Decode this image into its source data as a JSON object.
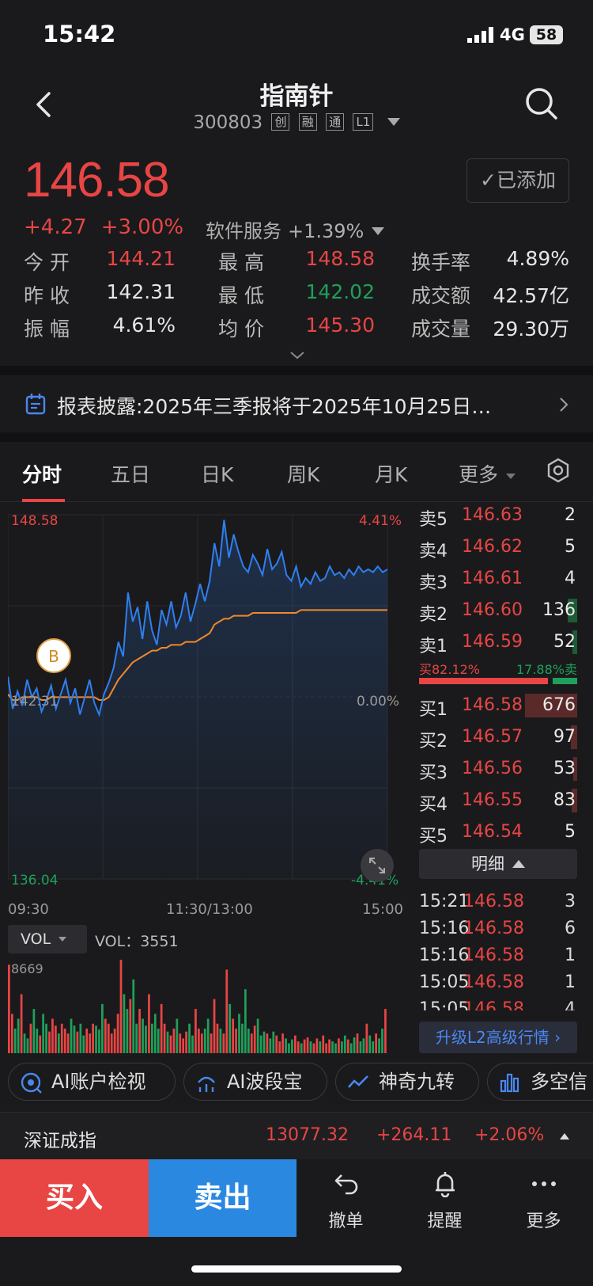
{
  "status": {
    "time": "15:42",
    "network": "4G",
    "battery": "58"
  },
  "header": {
    "title": "指南针",
    "code": "300803",
    "tags": [
      "创",
      "融",
      "通",
      "L1"
    ]
  },
  "quote": {
    "price": "146.58",
    "change": "+4.27",
    "change_pct": "+3.00%",
    "sector": "软件服务",
    "sector_pct": "+1.39%",
    "added_label": "已添加"
  },
  "stats": {
    "open_k": "今 开",
    "open_v": "144.21",
    "high_k": "最 高",
    "high_v": "148.58",
    "turnover_k": "换手率",
    "turnover_v": "4.89%",
    "prev_k": "昨 收",
    "prev_v": "142.31",
    "low_k": "最 低",
    "low_v": "142.02",
    "amount_k": "成交额",
    "amount_v": "42.57亿",
    "amp_k": "振 幅",
    "amp_v": "4.61%",
    "avg_k": "均 价",
    "avg_v": "145.30",
    "volume_k": "成交量",
    "volume_v": "29.30万"
  },
  "notice": "报表披露:2025年三季报将于2025年10月25日…",
  "tabs": [
    "分时",
    "五日",
    "日K",
    "周K",
    "月K",
    "更多"
  ],
  "chart_labels": {
    "top_price": "148.58",
    "mid_price": "142.31",
    "bottom_price": "136.04",
    "top_pct": "4.41%",
    "mid_pct": "0.00%",
    "bottom_pct": "-4.41%",
    "marker": "B",
    "time_start": "09:30",
    "time_mid": "11:30/13:00",
    "time_end": "15:00"
  },
  "chart_data": {
    "type": "line",
    "title": "",
    "ylim": [
      136.04,
      148.58
    ],
    "prev_close": 142.31,
    "x": [
      "09:30",
      "11:30/13:00",
      "15:00"
    ],
    "series": [
      {
        "values": [
          143.0,
          141.9,
          142.5,
          142.0,
          142.9,
          142.3,
          142.6,
          141.8,
          142.2,
          142.7,
          141.9,
          142.4,
          142.9,
          142.1,
          142.6,
          141.7,
          142.3,
          142.9,
          142.1,
          141.7,
          142.4,
          142.8,
          143.3,
          144.2,
          143.7,
          145.9,
          144.9,
          145.4,
          144.3,
          145.6,
          144.6,
          144.1,
          145.3,
          144.8,
          145.6,
          144.7,
          145.1,
          145.9,
          144.9,
          145.5,
          146.2,
          145.6,
          146.3,
          147.6,
          146.8,
          148.4,
          147.1,
          147.9,
          147.3,
          146.8,
          146.6,
          147.2,
          146.9,
          146.5,
          147.4,
          146.7,
          146.9,
          147.3,
          146.5,
          146.3,
          146.8,
          146.1,
          146.4,
          146.2,
          146.6,
          146.3,
          146.4,
          146.8,
          146.5,
          146.6,
          146.4,
          146.7,
          146.5,
          146.8,
          146.6,
          146.7,
          146.6,
          146.8,
          146.6,
          146.7
        ]
      },
      {
        "values": [
          142.4,
          142.2,
          142.2,
          142.3,
          142.3,
          142.3,
          142.3,
          142.2,
          142.2,
          142.3,
          142.3,
          142.3,
          142.3,
          142.3,
          142.3,
          142.3,
          142.3,
          142.3,
          142.3,
          142.2,
          142.2,
          142.3,
          142.6,
          142.9,
          143.1,
          143.3,
          143.5,
          143.6,
          143.7,
          143.8,
          143.9,
          143.9,
          144.0,
          144.0,
          144.1,
          144.1,
          144.1,
          144.2,
          144.2,
          144.2,
          144.3,
          144.4,
          144.5,
          144.8,
          144.9,
          145.0,
          145.0,
          145.1,
          145.1,
          145.1,
          145.1,
          145.2,
          145.2,
          145.2,
          145.2,
          145.2,
          145.2,
          145.2,
          145.2,
          145.2,
          145.2,
          145.3,
          145.3,
          145.3,
          145.3,
          145.3,
          145.3,
          145.3,
          145.3,
          145.3,
          145.3,
          145.3,
          145.3,
          145.3,
          145.3,
          145.3,
          145.3,
          145.3,
          145.3,
          145.3
        ]
      }
    ]
  },
  "volume": {
    "selector": "VOL",
    "label": "VOL：3551",
    "max": "8669",
    "bars": [
      90,
      40,
      25,
      35,
      60,
      20,
      15,
      30,
      45,
      25,
      18,
      40,
      30,
      22,
      35,
      28,
      20,
      30,
      25,
      20,
      35,
      28,
      22,
      30,
      18,
      25,
      20,
      30,
      28,
      24,
      50,
      35,
      30,
      20,
      25,
      40,
      95,
      60,
      45,
      55,
      75,
      30,
      45,
      35,
      28,
      60,
      30,
      40,
      25,
      50,
      30,
      22,
      18,
      25,
      35,
      20,
      15,
      22,
      30,
      18,
      45,
      25,
      20,
      25,
      35,
      20,
      55,
      30,
      25,
      20,
      85,
      50,
      35,
      25,
      40,
      30,
      65,
      25,
      20,
      28,
      35,
      18,
      22,
      20,
      15,
      22,
      18,
      12,
      20,
      15,
      10,
      14,
      18,
      12,
      10,
      14,
      16,
      12,
      10,
      15,
      12,
      18,
      10,
      14,
      12,
      10,
      15,
      12,
      18,
      14,
      10,
      16,
      20,
      12,
      15,
      30,
      18,
      12,
      20,
      15,
      25,
      45
    ]
  },
  "order_book": {
    "asks": [
      {
        "label": "卖5",
        "price": "146.63",
        "qty": "2"
      },
      {
        "label": "卖4",
        "price": "146.62",
        "qty": "5"
      },
      {
        "label": "卖3",
        "price": "146.61",
        "qty": "4"
      },
      {
        "label": "卖2",
        "price": "146.60",
        "qty": "136"
      },
      {
        "label": "卖1",
        "price": "146.59",
        "qty": "52"
      }
    ],
    "buy_ratio": "买82.12%",
    "sell_ratio": "17.88%卖",
    "buy_ratio_value": 82.12,
    "bids": [
      {
        "label": "买1",
        "price": "146.58",
        "qty": "676"
      },
      {
        "label": "买2",
        "price": "146.57",
        "qty": "97"
      },
      {
        "label": "买3",
        "price": "146.56",
        "qty": "53"
      },
      {
        "label": "买4",
        "price": "146.55",
        "qty": "83"
      },
      {
        "label": "买5",
        "price": "146.54",
        "qty": "5"
      }
    ],
    "detail_label": "明细",
    "trades": [
      {
        "time": "15:21",
        "price": "146.58",
        "qty": "3"
      },
      {
        "time": "15:16",
        "price": "146.58",
        "qty": "6"
      },
      {
        "time": "15:16",
        "price": "146.58",
        "qty": "1"
      },
      {
        "time": "15:05",
        "price": "146.58",
        "qty": "1"
      },
      {
        "time": "15:05",
        "price": "146.58",
        "qty": "4"
      }
    ],
    "upgrade_label": "升级L2高级行情"
  },
  "tools": [
    "AI账户检视",
    "AI波段宝",
    "神奇九转",
    "多空信"
  ],
  "index": {
    "name": "深证成指",
    "value": "13077.32",
    "change": "+264.11",
    "pct": "+2.06%"
  },
  "bottom": {
    "buy": "买入",
    "sell": "卖出",
    "cancel": "撤单",
    "alert": "提醒",
    "more": "更多"
  },
  "colors": {
    "up": "#e84545",
    "down": "#1fa05a",
    "price_line": "#2f7ff0",
    "avg_line": "#f0892a",
    "accent_blue": "#2a88e0"
  }
}
